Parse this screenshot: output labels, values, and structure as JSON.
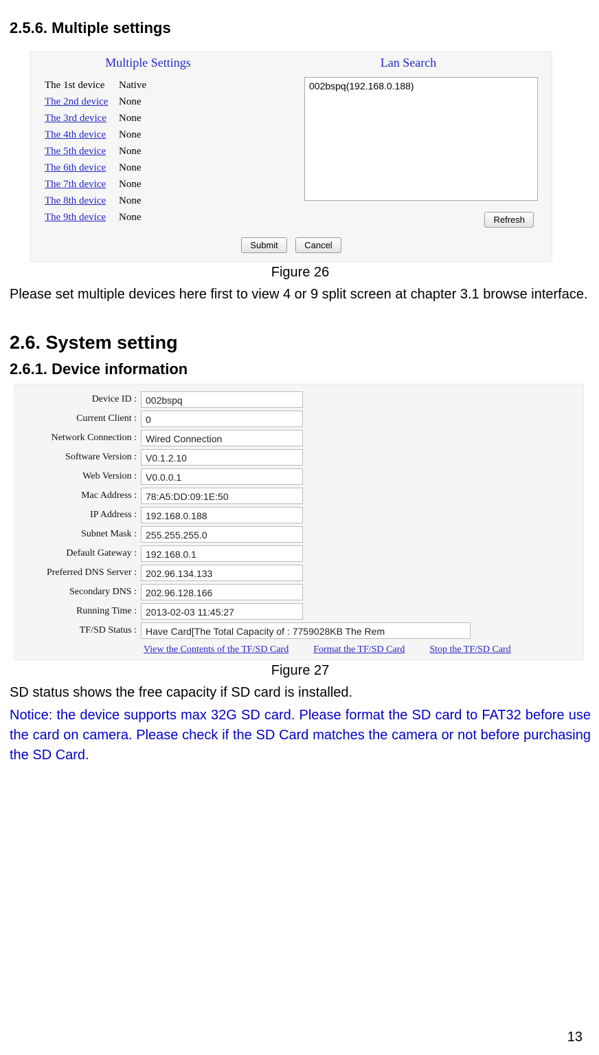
{
  "headings": {
    "h_256": "2.5.6.  Multiple settings",
    "h_26": "2.6. System setting",
    "h_261": "2.6.1.  Device information"
  },
  "figure26": {
    "caption": "Figure 26",
    "headers": {
      "left": "Multiple Settings",
      "right": "Lan Search"
    },
    "devices": [
      {
        "label": "The 1st device",
        "value": "Native",
        "link": false
      },
      {
        "label": "The 2nd device",
        "value": "None",
        "link": true
      },
      {
        "label": "The 3rd device",
        "value": "None",
        "link": true
      },
      {
        "label": "The 4th device",
        "value": "None",
        "link": true
      },
      {
        "label": "The 5th device",
        "value": "None",
        "link": true
      },
      {
        "label": "The 6th device",
        "value": "None",
        "link": true
      },
      {
        "label": "The 7th device",
        "value": "None",
        "link": true
      },
      {
        "label": "The 8th device",
        "value": "None",
        "link": true
      },
      {
        "label": "The 9th device",
        "value": "None",
        "link": true
      }
    ],
    "search_results": [
      "002bspq(192.168.0.188)"
    ],
    "buttons": {
      "refresh": "Refresh",
      "submit": "Submit",
      "cancel": "Cancel"
    },
    "after_text": "Please set multiple devices here first to view 4 or 9 split screen at chapter 3.1 browse interface."
  },
  "figure27": {
    "caption": "Figure 27",
    "rows": [
      {
        "label": "Device ID :",
        "value": "002bspq",
        "w": "mid"
      },
      {
        "label": "Current Client :",
        "value": "0",
        "w": "mid"
      },
      {
        "label": "Network Connection :",
        "value": "Wired Connection",
        "w": "mid"
      },
      {
        "label": "Software Version :",
        "value": "V0.1.2.10",
        "w": "mid"
      },
      {
        "label": "Web Version :",
        "value": "V0.0.0.1",
        "w": "mid"
      },
      {
        "label": "Mac Address :",
        "value": "78:A5:DD:09:1E:50",
        "w": "mid"
      },
      {
        "label": "IP Address :",
        "value": "192.168.0.188",
        "w": "mid"
      },
      {
        "label": "Subnet Mask :",
        "value": "255.255.255.0",
        "w": "mid"
      },
      {
        "label": "Default Gateway :",
        "value": "192.168.0.1",
        "w": "mid"
      },
      {
        "label": "Preferred DNS Server :",
        "value": "202.96.134.133",
        "w": "mid"
      },
      {
        "label": "Secondary DNS :",
        "value": "202.96.128.166",
        "w": "mid"
      },
      {
        "label": "Running Time :",
        "value": "2013-02-03 11:45:27",
        "w": "mid"
      },
      {
        "label": "TF/SD Status :",
        "value": "Have Card[The Total Capacity of : 7759028KB The Rem",
        "w": "wide"
      }
    ],
    "links": {
      "view": "View the Contents of the TF/SD Card",
      "format": "Format the TF/SD Card",
      "stop": "Stop the TF/SD Card"
    },
    "after_text_1": "SD status shows the free capacity if SD card is installed.",
    "after_text_2": "Notice: the device supports max 32G SD card. Please format the SD card to FAT32 before use the card on camera. Please check if the SD Card matches the camera or not before purchasing the SD Card."
  },
  "page_number": "13"
}
